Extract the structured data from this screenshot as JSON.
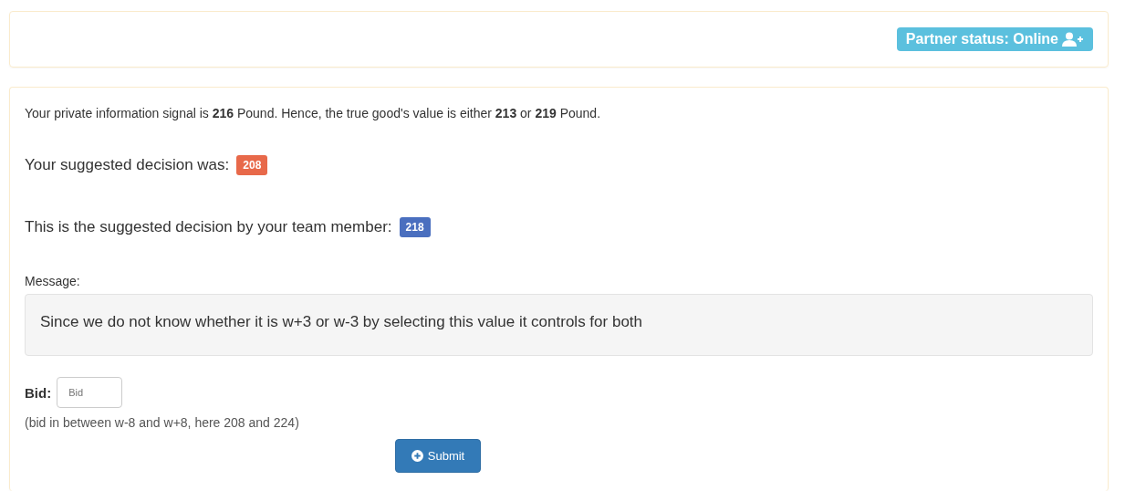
{
  "partner_status": {
    "label": "Partner status: Online"
  },
  "info": "Your private information signal is **216** Pound. Hence, the true good's value is either **213** or **219** Pound.",
  "decisions": [
    {
      "label": "Your suggested decision was:",
      "value": "208",
      "color": "#e8694a"
    },
    {
      "label": "This is the suggested decision by your team member:",
      "value": "218",
      "color": "#4a6fbf"
    }
  ],
  "message": {
    "label": "Message:",
    "text": "Since we do not know whether it is w+3 or w-3 by selecting this value it controls for both"
  },
  "bid": {
    "label": "Bid:",
    "placeholder": "Bid",
    "hint": "(bid in between w-8 and w+8, here 208 and 224)"
  },
  "submit": {
    "label": "Submit"
  }
}
